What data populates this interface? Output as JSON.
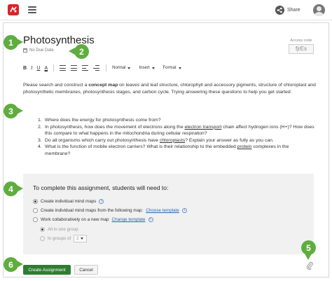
{
  "topbar": {
    "share_label": "Share",
    "icons": {
      "logo": "app-logo",
      "menu": "hamburger-menu-icon",
      "share": "share-icon",
      "avatar": "user-avatar-icon"
    }
  },
  "assignment": {
    "title": "Photosynthesis",
    "due_date": "No Due Date",
    "access_code_label": "Access code",
    "access_code": "fjrEs"
  },
  "toolbar": {
    "bold": "B",
    "italic": "I",
    "underline": "U",
    "text_color": "A",
    "style_dropdown": "Normal",
    "insert_dropdown": "Insert",
    "format_dropdown": "Format"
  },
  "description": {
    "part1": "Please search and construct a ",
    "bold": "concept map",
    "part2": " on leaves and leaf structure, chlorophyll and accessory pigments, structure of chloroplast and photosynthetic membranes, photosynthesis stages, and carbon cycle. Trying answering these questions to help you get started:"
  },
  "questions": [
    {
      "num": "1.",
      "text_a": "Where does the energy for photosynthesis come from?",
      "link": "",
      "text_b": ""
    },
    {
      "num": "2.",
      "text_a": "In photosynthesis, how does the movement of electrons along the ",
      "link": "electron transport",
      "text_b": " chain affect hydrogen ions (H+)? How does this compare to what happens in the mitochondria during cellular respiration?"
    },
    {
      "num": "3.",
      "text_a": "Do all organisms which carry out photosynthesis have ",
      "link": "chloroplasts",
      "text_b": "? Explain your answer as fully as you can."
    },
    {
      "num": "4.",
      "text_a": "What is the function of mobile electron carriers? What is their relationship to the embedded ",
      "link": "protein",
      "text_b": " complexes in the membrane?"
    }
  ],
  "requirements": {
    "heading": "To complete this assignment, students will need to:",
    "option1": "Create individual mind maps",
    "option2": "Create individual mind maps from the following map:",
    "option2_link": "Choose template",
    "option3": "Work collaboratively on a new map",
    "option3_link": "Change template",
    "sub1": "All in one group",
    "sub2": "In groups of",
    "group_size": "2"
  },
  "actions": {
    "create": "Create Assignment",
    "cancel": "Cancel"
  },
  "callouts": [
    "1",
    "2",
    "3",
    "4",
    "5",
    "6"
  ],
  "colors": {
    "brand_red": "#d6252b",
    "callout_green": "#5fad3f",
    "primary_button": "#2e7d32",
    "link_blue": "#2a64b4"
  }
}
